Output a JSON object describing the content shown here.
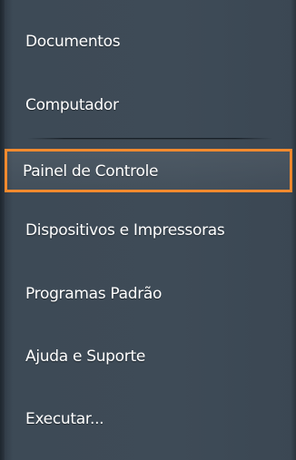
{
  "menu": {
    "items": [
      {
        "label": "Documentos"
      },
      {
        "label": "Computador"
      },
      {
        "label": "Painel de Controle",
        "highlighted": true
      },
      {
        "label": "Dispositivos e Impressoras"
      },
      {
        "label": "Programas Padrão"
      },
      {
        "label": "Ajuda e Suporte"
      },
      {
        "label": "Executar..."
      }
    ]
  },
  "colors": {
    "background": "#3d4a56",
    "highlight_border": "#f28a2e",
    "text": "#ffffff"
  }
}
